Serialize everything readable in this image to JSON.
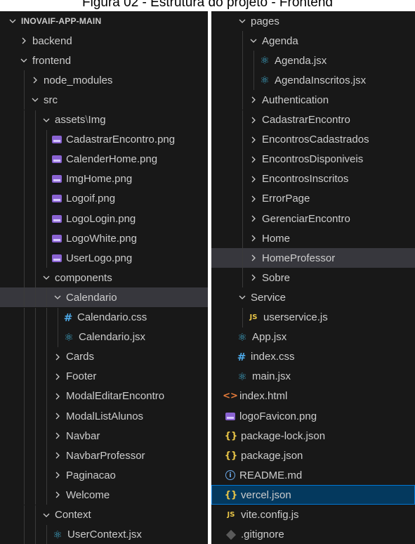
{
  "caption": "Figura 02 - Estrutura do projeto - Frontend",
  "colors": {
    "sidebar_bg": "#181818",
    "text": "#cccccc",
    "selection": "#37373d",
    "focus": "#04395e",
    "focus_border": "#0078d4",
    "image_icon": "#8a63d2",
    "react_icon": "#3fa7c9",
    "css_icon": "#4da9e8",
    "js_json_icon": "#e8c547",
    "html_icon": "#e57b3a"
  },
  "left_tree": [
    {
      "label": "INOVAIF-APP-MAIN",
      "indent": 0,
      "twisty": "open",
      "header": true
    },
    {
      "label": "backend",
      "indent": 1,
      "twisty": "closed"
    },
    {
      "label": "frontend",
      "indent": 1,
      "twisty": "open"
    },
    {
      "label": "node_modules",
      "indent": 2,
      "twisty": "closed"
    },
    {
      "label": "src",
      "indent": 2,
      "twisty": "open"
    },
    {
      "label": "assets",
      "label_suffix": "Img",
      "indent": 3,
      "twisty": "open"
    },
    {
      "label": "CadastrarEncontro.png",
      "indent": 4,
      "icon": "image-icon"
    },
    {
      "label": "CalenderHome.png",
      "indent": 4,
      "icon": "image-icon"
    },
    {
      "label": "ImgHome.png",
      "indent": 4,
      "icon": "image-icon"
    },
    {
      "label": "Logoif.png",
      "indent": 4,
      "icon": "image-icon"
    },
    {
      "label": "LogoLogin.png",
      "indent": 4,
      "icon": "image-icon"
    },
    {
      "label": "LogoWhite.png",
      "indent": 4,
      "icon": "image-icon"
    },
    {
      "label": "UserLogo.png",
      "indent": 4,
      "icon": "image-icon"
    },
    {
      "label": "components",
      "indent": 3,
      "twisty": "open"
    },
    {
      "label": "Calendario",
      "indent": 4,
      "twisty": "open",
      "selected": true
    },
    {
      "label": "Calendario.css",
      "indent": 5,
      "icon": "css-hash-icon"
    },
    {
      "label": "Calendario.jsx",
      "indent": 5,
      "icon": "react-icon"
    },
    {
      "label": "Cards",
      "indent": 4,
      "twisty": "closed"
    },
    {
      "label": "Footer",
      "indent": 4,
      "twisty": "closed"
    },
    {
      "label": "ModalEditarEncontro",
      "indent": 4,
      "twisty": "closed"
    },
    {
      "label": "ModalListAlunos",
      "indent": 4,
      "twisty": "closed"
    },
    {
      "label": "Navbar",
      "indent": 4,
      "twisty": "closed"
    },
    {
      "label": "NavbarProfessor",
      "indent": 4,
      "twisty": "closed"
    },
    {
      "label": "Paginacao",
      "indent": 4,
      "twisty": "closed"
    },
    {
      "label": "Welcome",
      "indent": 4,
      "twisty": "closed"
    },
    {
      "label": "Context",
      "indent": 3,
      "twisty": "open"
    },
    {
      "label": "UserContext.jsx",
      "indent": 4,
      "icon": "react-icon"
    }
  ],
  "right_tree": [
    {
      "label": "pages",
      "indent": 1,
      "twisty": "open"
    },
    {
      "label": "Agenda",
      "indent": 2,
      "twisty": "open"
    },
    {
      "label": "Agenda.jsx",
      "indent": 3,
      "icon": "react-icon"
    },
    {
      "label": "AgendaInscritos.jsx",
      "indent": 3,
      "icon": "react-icon"
    },
    {
      "label": "Authentication",
      "indent": 2,
      "twisty": "closed"
    },
    {
      "label": "CadastrarEncontro",
      "indent": 2,
      "twisty": "closed"
    },
    {
      "label": "EncontrosCadastrados",
      "indent": 2,
      "twisty": "closed"
    },
    {
      "label": "EncontrosDisponiveis",
      "indent": 2,
      "twisty": "closed"
    },
    {
      "label": "EncontrosInscritos",
      "indent": 2,
      "twisty": "closed"
    },
    {
      "label": "ErrorPage",
      "indent": 2,
      "twisty": "closed"
    },
    {
      "label": "GerenciarEncontro",
      "indent": 2,
      "twisty": "closed"
    },
    {
      "label": "Home",
      "indent": 2,
      "twisty": "closed"
    },
    {
      "label": "HomeProfessor",
      "indent": 2,
      "twisty": "closed",
      "selected": true
    },
    {
      "label": "Sobre",
      "indent": 2,
      "twisty": "closed"
    },
    {
      "label": "Service",
      "indent": 1,
      "twisty": "open"
    },
    {
      "label": "userservice.js",
      "indent": 2,
      "icon": "js-icon"
    },
    {
      "label": "App.jsx",
      "indent": 1,
      "icon": "react-icon"
    },
    {
      "label": "index.css",
      "indent": 1,
      "icon": "css-hash-icon"
    },
    {
      "label": "main.jsx",
      "indent": 1,
      "icon": "react-icon"
    },
    {
      "label": "index.html",
      "indent": 0,
      "icon": "html-icon"
    },
    {
      "label": "logoFavicon.png",
      "indent": 0,
      "icon": "image-icon"
    },
    {
      "label": "package-lock.json",
      "indent": 0,
      "icon": "json-icon"
    },
    {
      "label": "package.json",
      "indent": 0,
      "icon": "json-icon"
    },
    {
      "label": "README.md",
      "indent": 0,
      "icon": "info-icon"
    },
    {
      "label": "vercel.json",
      "indent": 0,
      "icon": "json-icon",
      "focused": true
    },
    {
      "label": "vite.config.js",
      "indent": 0,
      "icon": "js-icon"
    },
    {
      "label": ".gitignore",
      "indent": 0,
      "icon": "git-icon"
    }
  ]
}
